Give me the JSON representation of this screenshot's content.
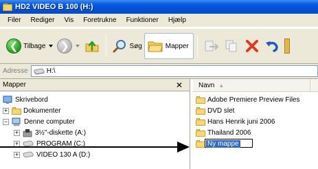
{
  "window": {
    "title": "HD2 VIDEO B 100 (H:)"
  },
  "menu": [
    "Filer",
    "Rediger",
    "Vis",
    "Foretrukne",
    "Funktioner",
    "Hjælp"
  ],
  "toolbar": {
    "back_label": "Tilbage",
    "search_label": "Søg",
    "folders_label": "Mapper"
  },
  "address": {
    "label": "Adresse",
    "value": "H:\\"
  },
  "folders_pane": {
    "header": "Mapper",
    "close_symbol": "✕",
    "tree": [
      {
        "label": "Skrivebord",
        "icon": "desktop-icon"
      },
      {
        "label": "Dokumenter",
        "icon": "documents-folder-icon",
        "expander": "+"
      },
      {
        "label": "Denne computer",
        "icon": "computer-icon",
        "expander": "−"
      },
      {
        "label": "3½\"-diskette (A:)",
        "icon": "floppy-icon",
        "expander": "+"
      },
      {
        "label": "PROGRAM (C:)",
        "icon": "drive-icon",
        "expander": "+"
      },
      {
        "label": "VIDEO 130 A (D:)",
        "icon": "drive-icon",
        "expander": "+"
      }
    ]
  },
  "file_list": {
    "column_name": "Navn",
    "sort_indicator": "▲",
    "items": [
      "Adobe Premiere Preview Files",
      "DVD slet",
      "Hans Henrik juni 2006",
      "Thailand 2006"
    ],
    "rename_value": "Ny mappe"
  }
}
